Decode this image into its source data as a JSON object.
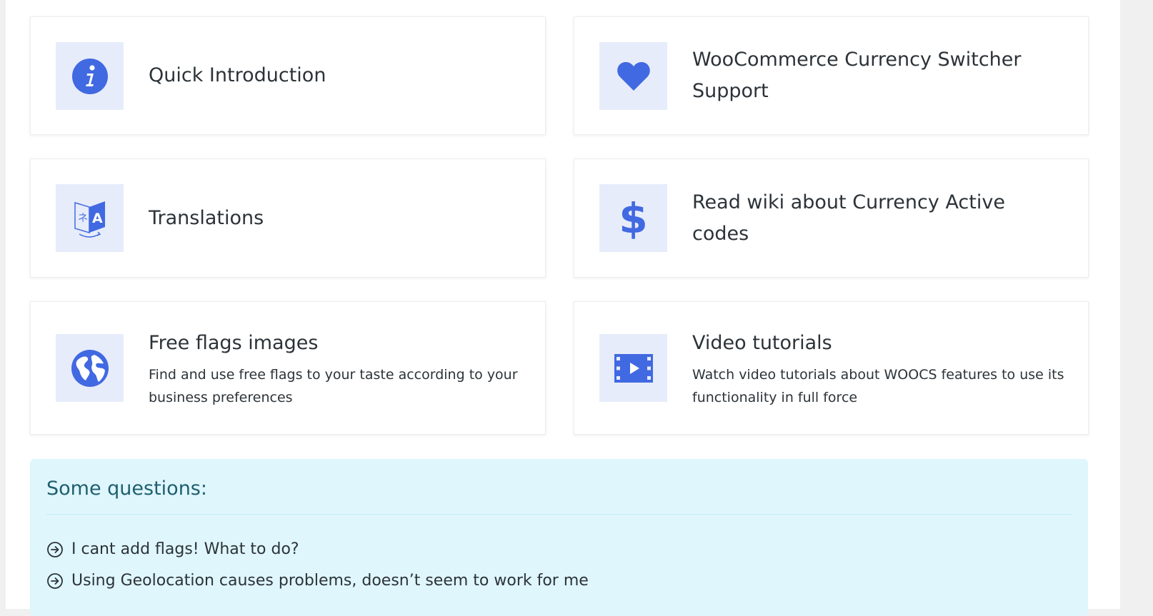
{
  "cards": [
    {
      "title": "Quick Introduction",
      "icon": "info-icon"
    },
    {
      "title": "WooCommerce Currency Switcher Support",
      "icon": "heart-icon"
    },
    {
      "title": "Translations",
      "icon": "translate-icon"
    },
    {
      "title": "Read wiki about Currency Active codes",
      "icon": "dollar-icon"
    },
    {
      "title": "Free flags images",
      "description": "Find and use free flags to your taste according to your business preferences",
      "icon": "globe-icon"
    },
    {
      "title": "Video tutorials",
      "description": "Watch video tutorials about WOOCS features to use its functionality in full force",
      "icon": "video-icon"
    }
  ],
  "questions": {
    "heading": "Some questions:",
    "items": [
      "I cant add flags! What to do?",
      "Using Geolocation causes problems, doesn’t seem to work for me"
    ]
  },
  "colors": {
    "accent": "#4169e1",
    "icon_bg": "#e7ecfb",
    "info_bg": "#dff6fd",
    "info_heading": "#1f5f6e"
  }
}
